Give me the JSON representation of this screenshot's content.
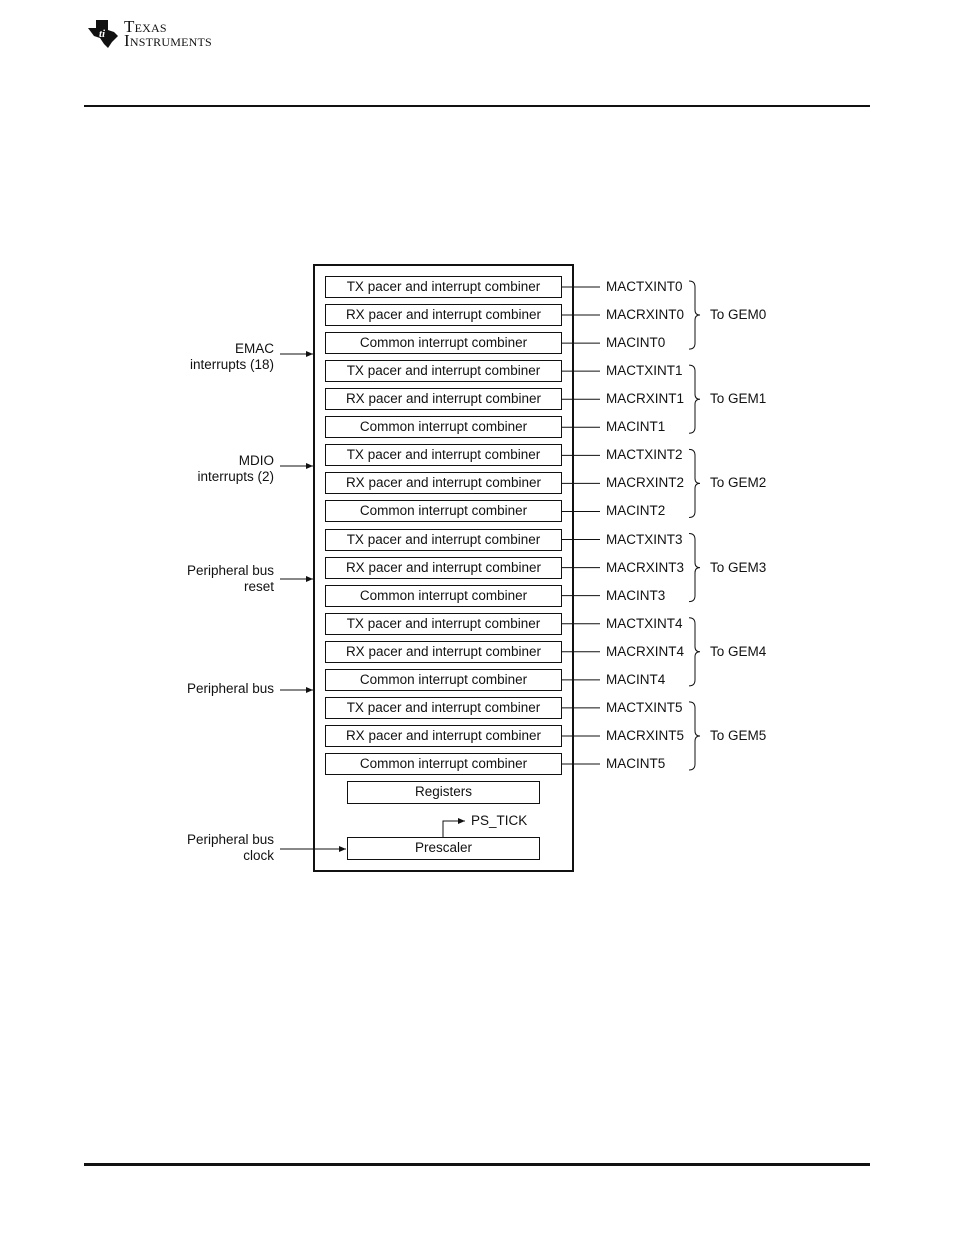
{
  "header": {
    "logo_text_line1": "Texas",
    "logo_text_line2": "Instruments"
  },
  "diagram": {
    "rows": [
      {
        "block": "TX pacer and interrupt combiner",
        "signal": "MACTXINT0"
      },
      {
        "block": "RX pacer and interrupt combiner",
        "signal": "MACRXINT0"
      },
      {
        "block": "Common interrupt combiner",
        "signal": "MACINT0"
      },
      {
        "block": "TX pacer and interrupt combiner",
        "signal": "MACTXINT1"
      },
      {
        "block": "RX pacer and interrupt combiner",
        "signal": "MACRXINT1"
      },
      {
        "block": "Common interrupt combiner",
        "signal": "MACINT1"
      },
      {
        "block": "TX pacer and interrupt combiner",
        "signal": "MACTXINT2"
      },
      {
        "block": "RX pacer and interrupt combiner",
        "signal": "MACRXINT2"
      },
      {
        "block": "Common interrupt combiner",
        "signal": "MACINT2"
      },
      {
        "block": "TX pacer and interrupt combiner",
        "signal": "MACTXINT3"
      },
      {
        "block": "RX pacer and interrupt combiner",
        "signal": "MACRXINT3"
      },
      {
        "block": "Common interrupt combiner",
        "signal": "MACINT3"
      },
      {
        "block": "TX pacer and interrupt combiner",
        "signal": "MACTXINT4"
      },
      {
        "block": "RX pacer and interrupt combiner",
        "signal": "MACRXINT4"
      },
      {
        "block": "Common interrupt combiner",
        "signal": "MACINT4"
      },
      {
        "block": "TX pacer and interrupt combiner",
        "signal": "MACTXINT5"
      },
      {
        "block": "RX pacer and interrupt combiner",
        "signal": "MACRXINT5"
      },
      {
        "block": "Common interrupt combiner",
        "signal": "MACINT5"
      }
    ],
    "groups": [
      "To GEM0",
      "To GEM1",
      "To GEM2",
      "To GEM3",
      "To GEM4",
      "To GEM5"
    ],
    "inputs": [
      {
        "line1": "EMAC",
        "line2": "interrupts (18)"
      },
      {
        "line1": "MDIO",
        "line2": "interrupts (2)"
      },
      {
        "line1": "Peripheral bus",
        "line2": "reset"
      },
      {
        "line1": "Peripheral bus",
        "line2": ""
      },
      {
        "line1": "Peripheral bus",
        "line2": "clock"
      }
    ],
    "registers": "Registers",
    "prescaler": "Prescaler",
    "ps_tick": "PS_TICK"
  }
}
